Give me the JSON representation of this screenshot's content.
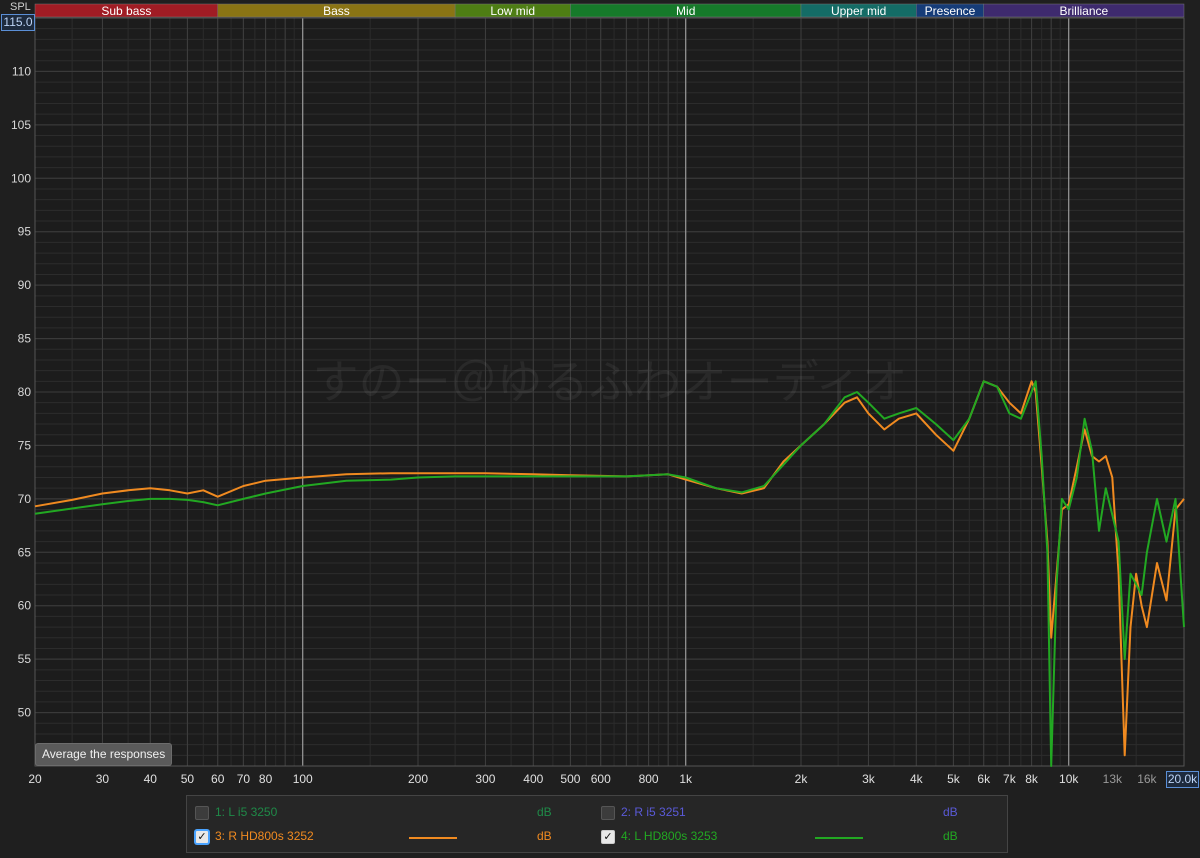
{
  "bands": [
    {
      "label": "Sub bass",
      "from": 20,
      "to": 60,
      "color": "#a01c24"
    },
    {
      "label": "Bass",
      "from": 60,
      "to": 250,
      "color": "#8a7414"
    },
    {
      "label": "Low mid",
      "from": 250,
      "to": 500,
      "color": "#4e7e14"
    },
    {
      "label": "Mid",
      "from": 500,
      "to": 2000,
      "color": "#167a2a"
    },
    {
      "label": "Upper mid",
      "from": 2000,
      "to": 4000,
      "color": "#146c66"
    },
    {
      "label": "Presence",
      "from": 4000,
      "to": 6000,
      "color": "#163c78"
    },
    {
      "label": "Brilliance",
      "from": 6000,
      "to": 20000,
      "color": "#3e2a6e"
    }
  ],
  "axis": {
    "y_label": "SPL",
    "y_top_value": "115.0",
    "x_right_value": "20.0k"
  },
  "avg_button_label": "Average the responses",
  "watermark": "すのー＠ゆるふわオーディオ",
  "legend": [
    {
      "checked": false,
      "label": "1: L i5 3250",
      "unit": "dB",
      "color": "#1f8a48",
      "show_swatch": false
    },
    {
      "checked": false,
      "label": "2: R i5 3251",
      "unit": "dB",
      "color": "#5a5ad8",
      "show_swatch": false
    },
    {
      "checked": true,
      "label": "3: R HD800s 3252",
      "unit": "dB",
      "color": "#f08a20",
      "show_swatch": true
    },
    {
      "checked": true,
      "label": "4: L HD800s 3253",
      "unit": "dB",
      "color": "#22a822",
      "show_swatch": true
    }
  ],
  "chart_data": {
    "type": "line",
    "xscale": "log",
    "xlim": [
      20,
      20000
    ],
    "ylim": [
      45,
      115
    ],
    "grid": true,
    "ylabel": "SPL",
    "y_ticks": [
      50,
      55,
      60,
      65,
      70,
      75,
      80,
      85,
      90,
      95,
      100,
      105,
      110
    ],
    "x_ticks": [
      {
        "v": 20,
        "label": "20"
      },
      {
        "v": 30,
        "label": "30"
      },
      {
        "v": 40,
        "label": "40"
      },
      {
        "v": 50,
        "label": "50"
      },
      {
        "v": 60,
        "label": "60"
      },
      {
        "v": 70,
        "label": "70"
      },
      {
        "v": 80,
        "label": "80"
      },
      {
        "v": 100,
        "label": "100"
      },
      {
        "v": 200,
        "label": "200"
      },
      {
        "v": 300,
        "label": "300"
      },
      {
        "v": 400,
        "label": "400"
      },
      {
        "v": 500,
        "label": "500"
      },
      {
        "v": 600,
        "label": "600"
      },
      {
        "v": 800,
        "label": "800"
      },
      {
        "v": 1000,
        "label": "1k"
      },
      {
        "v": 2000,
        "label": "2k"
      },
      {
        "v": 3000,
        "label": "3k"
      },
      {
        "v": 4000,
        "label": "4k"
      },
      {
        "v": 5000,
        "label": "5k"
      },
      {
        "v": 6000,
        "label": "6k"
      },
      {
        "v": 7000,
        "label": "7k"
      },
      {
        "v": 8000,
        "label": "8k"
      },
      {
        "v": 10000,
        "label": "10k"
      },
      {
        "v": 13000,
        "label": "13k",
        "dim": true
      },
      {
        "v": 16000,
        "label": "16k",
        "dim": true
      }
    ],
    "series": [
      {
        "name": "3: R HD800s 3252",
        "color": "#f08a20",
        "x": [
          20,
          25,
          30,
          35,
          40,
          45,
          50,
          55,
          60,
          70,
          80,
          100,
          130,
          170,
          200,
          250,
          300,
          400,
          500,
          700,
          900,
          1000,
          1200,
          1400,
          1600,
          1800,
          2000,
          2300,
          2600,
          2800,
          3000,
          3300,
          3600,
          4000,
          4500,
          5000,
          5500,
          6000,
          6500,
          7000,
          7500,
          8000,
          8200,
          8500,
          8800,
          9000,
          9300,
          9600,
          10000,
          10500,
          11000,
          11500,
          12000,
          12500,
          13000,
          13500,
          14000,
          14500,
          15000,
          15500,
          16000,
          17000,
          18000,
          19000,
          20000
        ],
        "y": [
          69.3,
          69.9,
          70.5,
          70.8,
          71.0,
          70.8,
          70.5,
          70.8,
          70.2,
          71.2,
          71.7,
          72.0,
          72.3,
          72.4,
          72.4,
          72.4,
          72.4,
          72.3,
          72.2,
          72.1,
          72.3,
          71.8,
          71.0,
          70.5,
          71.0,
          73.5,
          75.0,
          77.0,
          79.0,
          79.5,
          78.0,
          76.5,
          77.5,
          78.0,
          76.0,
          74.5,
          77.5,
          81.0,
          80.5,
          79.0,
          78.0,
          81.0,
          80.0,
          73.0,
          66.0,
          57.0,
          63.0,
          69.0,
          69.5,
          73.0,
          76.5,
          74.0,
          73.5,
          74.0,
          72.0,
          63.0,
          46.0,
          58.0,
          63.0,
          60.0,
          58.0,
          64.0,
          60.5,
          69.0,
          70.0
        ]
      },
      {
        "name": "4: L HD800s 3253",
        "color": "#22a822",
        "x": [
          20,
          25,
          30,
          35,
          40,
          45,
          50,
          55,
          60,
          70,
          80,
          100,
          130,
          170,
          200,
          250,
          300,
          400,
          500,
          700,
          900,
          1000,
          1200,
          1400,
          1600,
          1800,
          2000,
          2300,
          2600,
          2800,
          3000,
          3300,
          3600,
          4000,
          4500,
          5000,
          5500,
          6000,
          6500,
          7000,
          7500,
          8000,
          8200,
          8500,
          8800,
          9000,
          9300,
          9600,
          10000,
          10500,
          11000,
          11500,
          12000,
          12500,
          13000,
          13500,
          14000,
          14500,
          15000,
          15500,
          16000,
          17000,
          18000,
          19000,
          20000
        ],
        "y": [
          68.6,
          69.1,
          69.5,
          69.8,
          70.0,
          70.0,
          69.9,
          69.7,
          69.4,
          70.0,
          70.5,
          71.2,
          71.7,
          71.8,
          72.0,
          72.1,
          72.1,
          72.1,
          72.1,
          72.1,
          72.3,
          72.0,
          71.0,
          70.6,
          71.2,
          73.2,
          75.0,
          77.0,
          79.5,
          80.0,
          79.0,
          77.5,
          78.0,
          78.5,
          77.0,
          75.5,
          77.5,
          81.0,
          80.5,
          78.0,
          77.5,
          80.0,
          81.0,
          74.0,
          65.0,
          45.0,
          62.0,
          70.0,
          69.0,
          72.0,
          77.5,
          74.5,
          67.0,
          71.0,
          68.5,
          66.0,
          55.0,
          63.0,
          62.0,
          61.0,
          65.0,
          70.0,
          66.0,
          70.0,
          58.0
        ]
      }
    ]
  }
}
